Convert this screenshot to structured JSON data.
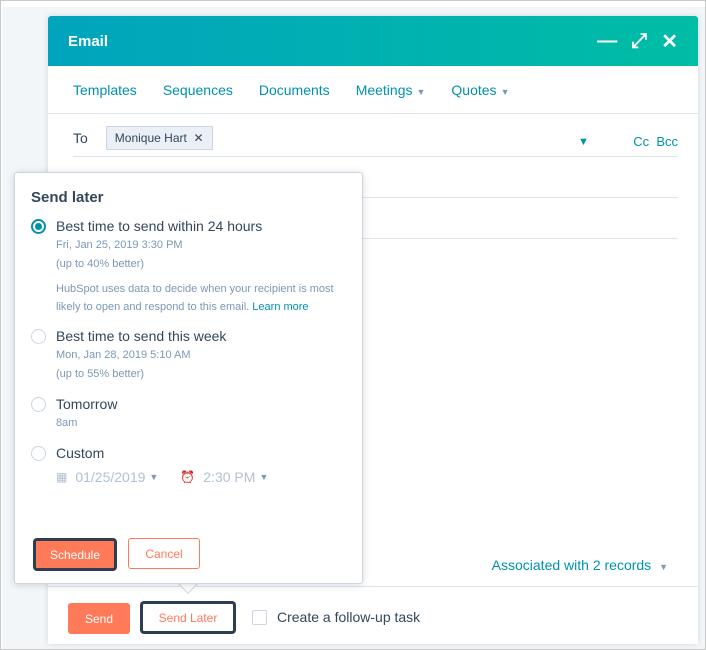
{
  "window": {
    "title": "Email",
    "controls": [
      "minimize-icon",
      "expand-icon",
      "close-icon"
    ]
  },
  "nav": [
    {
      "label": "Templates"
    },
    {
      "label": "Sequences"
    },
    {
      "label": "Documents"
    },
    {
      "label": "Meetings",
      "dropdown": true
    },
    {
      "label": "Quotes",
      "dropdown": true
    }
  ],
  "to": {
    "label": "To",
    "recipient": "Monique Hart",
    "cc": "Cc",
    "bcc": "Bcc"
  },
  "associated": "Associated with 2 records",
  "footer": {
    "send": "Send",
    "send_later": "Send Later",
    "follow_up": "Create a follow-up task"
  },
  "popover": {
    "title": "Send later",
    "options": [
      {
        "label": "Best time to send within 24 hours",
        "selected": true,
        "date": "Fri, Jan 25, 2019 3:30 PM",
        "improvement": "(up to 40% better)",
        "description": "HubSpot uses data to decide when your recipient is most likely to open and respond to this email.",
        "learn_more": "Learn more"
      },
      {
        "label": "Best time to send this week",
        "selected": false,
        "date": "Mon, Jan 28, 2019 5:10 AM",
        "improvement": "(up to 55% better)"
      },
      {
        "label": "Tomorrow",
        "selected": false,
        "date": "8am"
      },
      {
        "label": "Custom",
        "selected": false,
        "custom_date": "01/25/2019",
        "custom_time": "2:30 PM"
      }
    ],
    "schedule": "Schedule",
    "cancel": "Cancel"
  },
  "colors": {
    "header_start": "#00a4bd",
    "header_end": "#00bda5",
    "accent": "#ff7a59",
    "link": "#0091ae"
  }
}
